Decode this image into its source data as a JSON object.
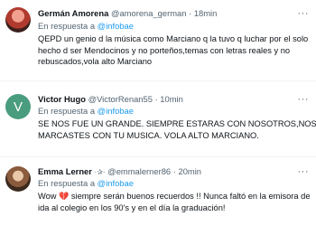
{
  "tweets": [
    {
      "name": "Germán Amorena",
      "handle": "@amorena_german",
      "time": "18min",
      "reply_prefix": "En respuesta a",
      "reply_to": "@infobae",
      "body_lines": [
        "QEPD un genio d la música como Marciano q la tuvo q luchar por el solo",
        "hecho d ser Mendocinos y no porteños,temas con letras reales y no",
        "rebuscados,vola alto Marciano"
      ],
      "more": "···"
    },
    {
      "name": "Victor Hugo",
      "handle": "@VictorRenan55",
      "time": "10min",
      "avatar_letter": "V",
      "reply_prefix": "En respuesta a",
      "reply_to": "@infobae",
      "body_lines": [
        "SE NOS FUE UN GRANDE. SIEMPRE ESTARAS CON NOSOTROS,NOS",
        "MARCASTES CON TU MUSICA. VOLA ALTO  MARCIANO."
      ],
      "more": "···"
    },
    {
      "name": "Emma Lerner",
      "name_badge": "·✰·",
      "handle": "@emmalerner86",
      "time": "20min",
      "reply_prefix": "En respuesta a",
      "reply_to": "@infobae",
      "body_line1_before": "Wow",
      "body_emoji": "💔",
      "body_line1_after": "siempre serán buenos recuerdos !! Nunca faltó en la emisora de",
      "body_line2": "ida al colegio en los 90's y en el día la graduación!",
      "more": "···"
    }
  ]
}
